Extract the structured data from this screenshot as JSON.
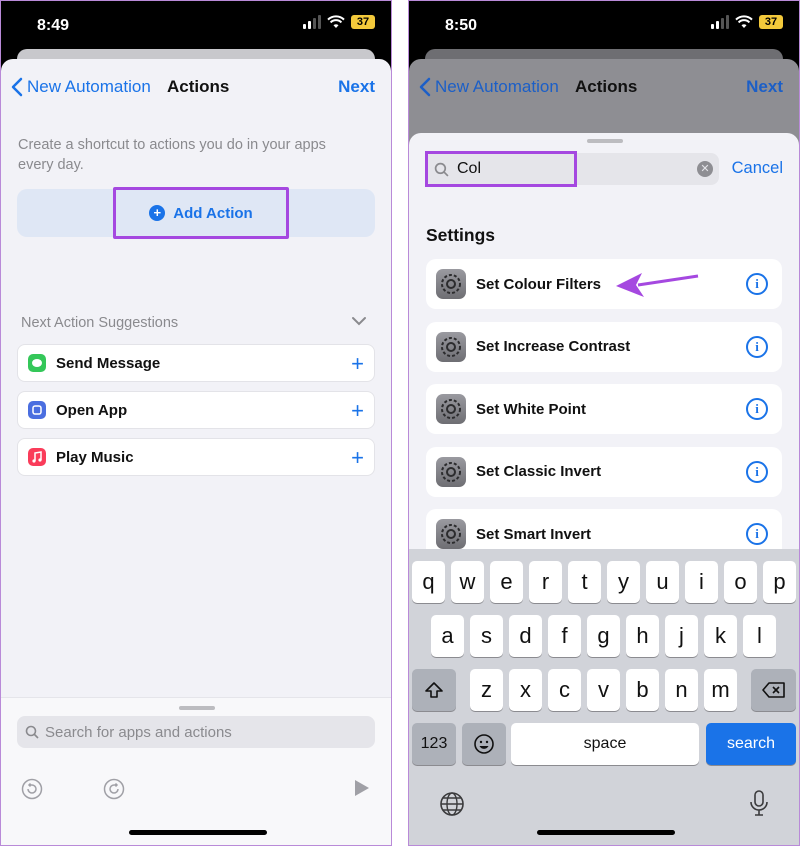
{
  "left": {
    "status": {
      "time": "8:49",
      "battery": "37"
    },
    "nav": {
      "back": "New Automation",
      "title": "Actions",
      "next": "Next"
    },
    "intro": "Create a shortcut to actions you do in your apps every day.",
    "add_action": "Add Action",
    "suggestions_title": "Next Action Suggestions",
    "suggestions": [
      {
        "label": "Send Message",
        "color": "#34c759"
      },
      {
        "label": "Open App",
        "color": "#4a6ee0"
      },
      {
        "label": "Play Music",
        "color": "#fa3c5a"
      }
    ],
    "search_placeholder": "Search for apps and actions"
  },
  "right": {
    "status": {
      "time": "8:50",
      "battery": "37"
    },
    "nav": {
      "back": "New Automation",
      "title": "Actions",
      "next": "Next"
    },
    "search_value": "Col",
    "cancel": "Cancel",
    "section": "Settings",
    "results": [
      {
        "label": "Set Colour Filters"
      },
      {
        "label": "Set Increase Contrast"
      },
      {
        "label": "Set White Point"
      },
      {
        "label": "Set Classic Invert"
      },
      {
        "label": "Set Smart Invert"
      }
    ],
    "keyboard": {
      "row1": [
        "q",
        "w",
        "e",
        "r",
        "t",
        "y",
        "u",
        "i",
        "o",
        "p"
      ],
      "row2": [
        "a",
        "s",
        "d",
        "f",
        "g",
        "h",
        "j",
        "k",
        "l"
      ],
      "row3": [
        "z",
        "x",
        "c",
        "v",
        "b",
        "n",
        "m"
      ],
      "numbers": "123",
      "space": "space",
      "search": "search"
    }
  },
  "colors": {
    "accent": "#1a73e8",
    "highlight": "#a548e0"
  }
}
